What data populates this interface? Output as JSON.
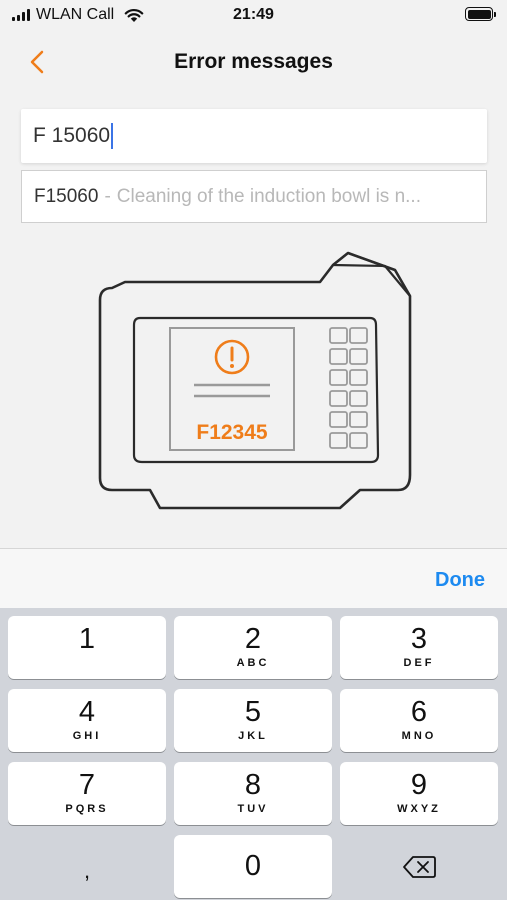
{
  "status_bar": {
    "carrier": "WLAN Call",
    "time": "21:49",
    "signal_bars": 4,
    "battery_level": 1.0
  },
  "nav": {
    "back_icon": "chevron-left-icon",
    "title": "Error messages"
  },
  "search": {
    "value": "F 15060"
  },
  "result": {
    "code": "F15060",
    "separator": "-",
    "description": "Cleaning of the induction bowl is n..."
  },
  "illustration": {
    "error_code": "F12345",
    "icon": "exclamation-circle-icon"
  },
  "keyboard": {
    "done_label": "Done",
    "keys": [
      {
        "digit": "1",
        "letters": ""
      },
      {
        "digit": "2",
        "letters": "ABC"
      },
      {
        "digit": "3",
        "letters": "DEF"
      },
      {
        "digit": "4",
        "letters": "GHI"
      },
      {
        "digit": "5",
        "letters": "JKL"
      },
      {
        "digit": "6",
        "letters": "MNO"
      },
      {
        "digit": "7",
        "letters": "PQRS"
      },
      {
        "digit": "8",
        "letters": "TUV"
      },
      {
        "digit": "9",
        "letters": "WXYZ"
      },
      {
        "digit": ",",
        "letters": ""
      },
      {
        "digit": "0",
        "letters": ""
      }
    ],
    "delete_icon": "backspace-icon"
  },
  "colors": {
    "accent": "#ef7d1a",
    "done_blue": "#1d8af0",
    "caret": "#3b74e6"
  }
}
